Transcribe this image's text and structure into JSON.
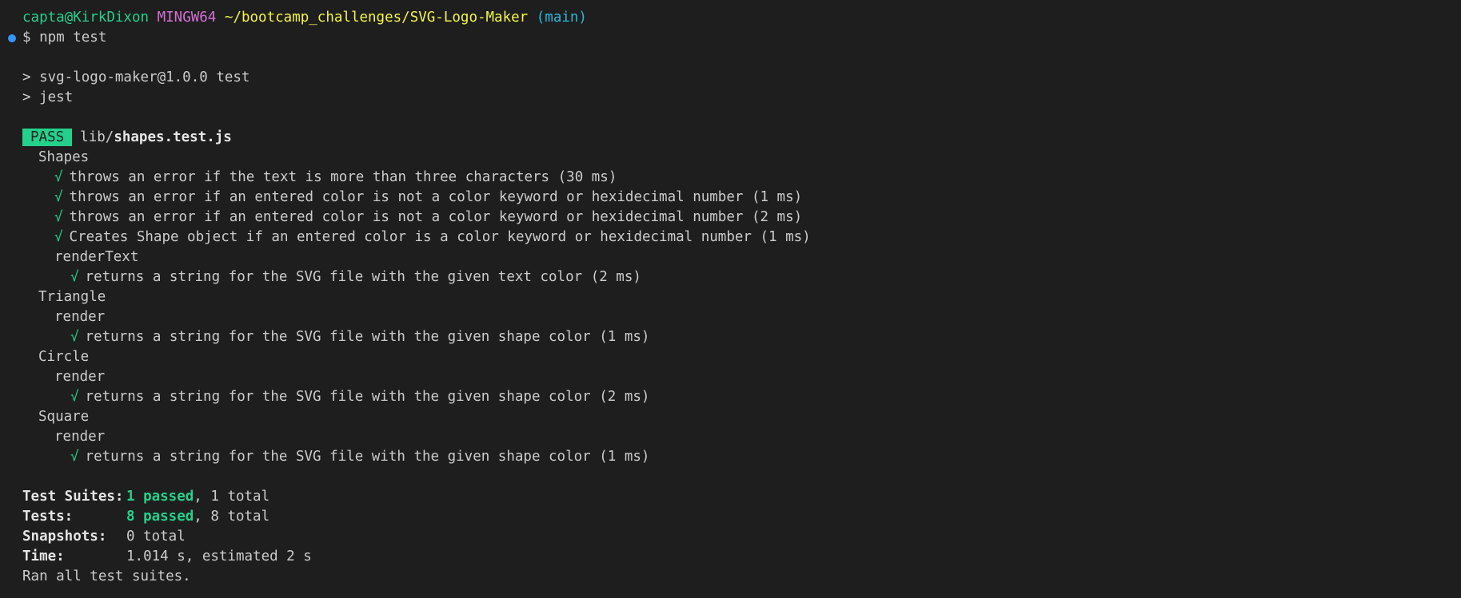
{
  "prompt": {
    "user_host": "capta@KirkDixon",
    "shell": "MINGW64",
    "path": "~/bootcamp_challenges/SVG-Logo-Maker",
    "branch": "(main)",
    "symbol": "$",
    "command": "npm test"
  },
  "script_lines": [
    "> svg-logo-maker@1.0.0 test",
    "> jest"
  ],
  "result": {
    "badge": "PASS",
    "file_dir": "lib/",
    "file_name": "shapes.test.js"
  },
  "check_glyph": "√",
  "tests": {
    "shapes_group": "Shapes",
    "shapes_items": [
      "throws an error if the text is more than three characters (30 ms)",
      "throws an error if an entered color is not a color keyword or hexidecimal number (1 ms)",
      "throws an error if an entered color is not a color keyword or hexidecimal number (2 ms)",
      "Creates Shape object if an entered color is a color keyword or hexidecimal number (1 ms)"
    ],
    "render_text_group": "renderText",
    "render_text_item": "returns a string for the SVG file with the given text color (2 ms)",
    "triangle_group": "Triangle",
    "triangle_sub": "render",
    "triangle_item": "returns a string for the SVG file with the given shape color (1 ms)",
    "circle_group": "Circle",
    "circle_sub": "render",
    "circle_item": "returns a string for the SVG file with the given shape color (2 ms)",
    "square_group": "Square",
    "square_sub": "render",
    "square_item": "returns a string for the SVG file with the given shape color (1 ms)"
  },
  "summary": {
    "suites_label": "Test Suites:",
    "suites_passed": "1 passed",
    "suites_total": ", 1 total",
    "tests_label": "Tests:",
    "tests_passed": "8 passed",
    "tests_total": ", 8 total",
    "snapshots_label": "Snapshots:",
    "snapshots_value": "0 total",
    "time_label": "Time:",
    "time_value": "1.014 s, estimated 2 s",
    "footer": "Ran all test suites."
  },
  "colors": {
    "background": "#1e1e1e",
    "green": "#23d18b",
    "magenta": "#d670d6",
    "yellow": "#f5f543",
    "cyan": "#29b8db"
  }
}
